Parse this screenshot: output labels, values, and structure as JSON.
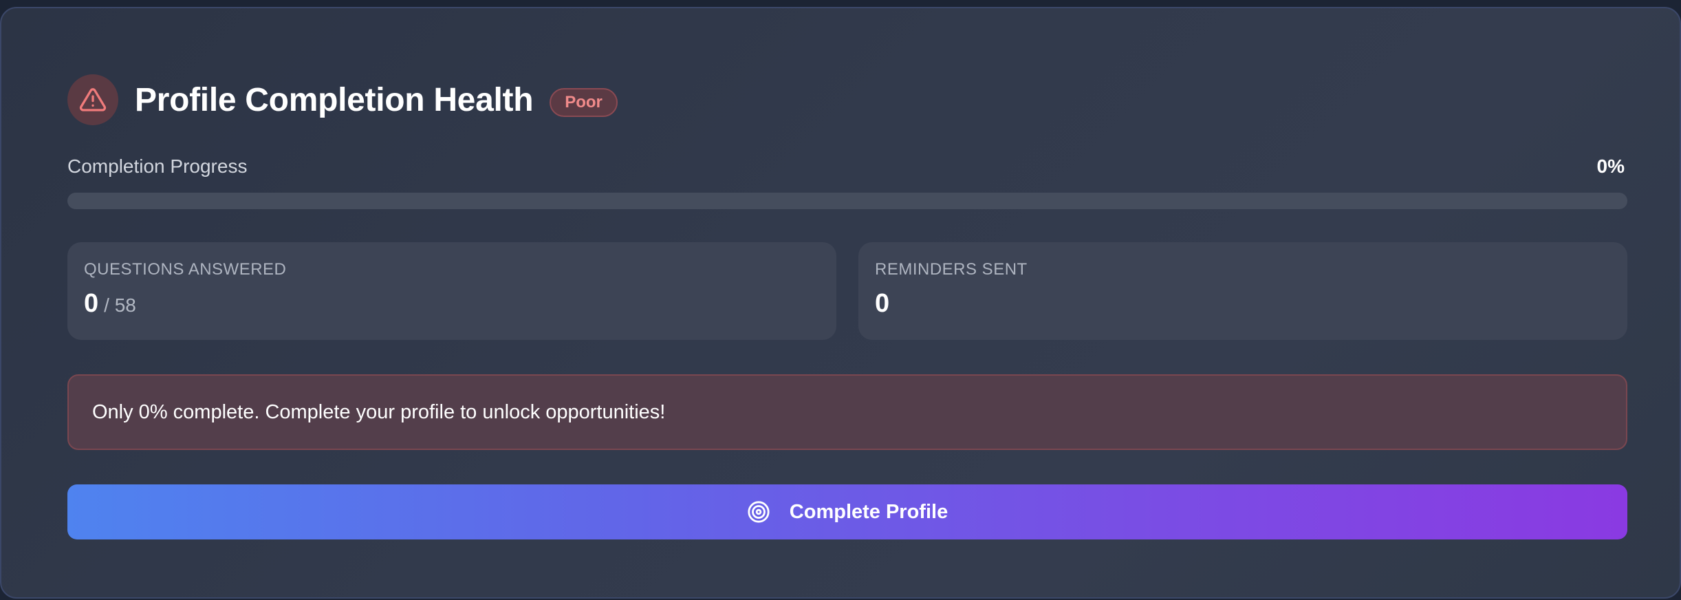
{
  "header": {
    "icon": "alert-triangle-icon",
    "title": "Profile Completion Health",
    "badge": "Poor"
  },
  "progress": {
    "label": "Completion Progress",
    "value_text": "0%",
    "value": 0
  },
  "stats": {
    "questions": {
      "label": "QUESTIONS ANSWERED",
      "value": "0",
      "total": "/ 58"
    },
    "reminders": {
      "label": "REMINDERS SENT",
      "value": "0"
    }
  },
  "alert": {
    "message": "Only 0% complete. Complete your profile to unlock opportunities!"
  },
  "cta": {
    "icon": "target-icon",
    "label": "Complete Profile"
  },
  "colors": {
    "danger": "#f08a8a",
    "gradient_start": "#4f83ef",
    "gradient_end": "#8a3ae2"
  }
}
